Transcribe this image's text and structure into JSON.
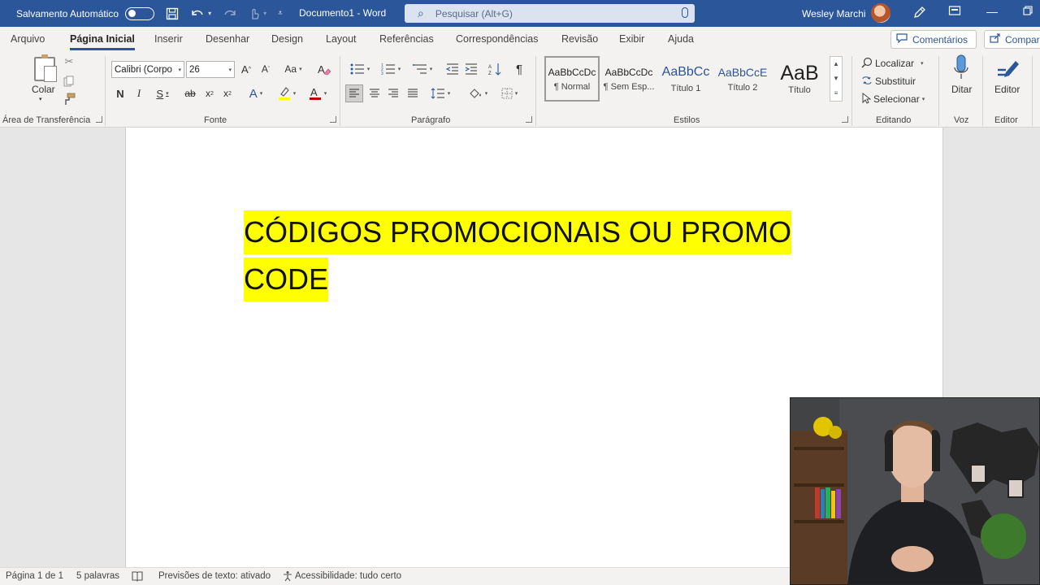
{
  "titlebar": {
    "autosave_label": "Salvamento Automático",
    "doc_title": "Documento1  -  Word",
    "search_placeholder": "Pesquisar (Alt+G)",
    "user_name": "Wesley Marchi"
  },
  "tabs": [
    {
      "label": "Arquivo"
    },
    {
      "label": "Página Inicial",
      "active": true
    },
    {
      "label": "Inserir"
    },
    {
      "label": "Desenhar"
    },
    {
      "label": "Design"
    },
    {
      "label": "Layout"
    },
    {
      "label": "Referências"
    },
    {
      "label": "Correspondências"
    },
    {
      "label": "Revisão"
    },
    {
      "label": "Exibir"
    },
    {
      "label": "Ajuda"
    }
  ],
  "comments_label": "Comentários",
  "share_label": "Compar",
  "ribbon": {
    "clipboard": {
      "paste_label": "Colar",
      "group_label": "Área de Transferência"
    },
    "font": {
      "font_name": "Calibri (Corpo",
      "font_size": "26",
      "group_label": "Fonte"
    },
    "paragraph": {
      "group_label": "Parágrafo"
    },
    "styles": {
      "group_label": "Estilos",
      "items": [
        {
          "sample": "AaBbCcDc",
          "name": "¶ Normal"
        },
        {
          "sample": "AaBbCcDc",
          "name": "¶ Sem Esp..."
        },
        {
          "sample": "AaBbCc",
          "name": "Título 1"
        },
        {
          "sample": "AaBbCcE",
          "name": "Título 2"
        },
        {
          "sample": "AaB",
          "name": "Título"
        }
      ]
    },
    "editing": {
      "find": "Localizar",
      "replace": "Substituir",
      "select": "Selecionar",
      "group_label": "Editando"
    },
    "voice": {
      "dictate": "Ditar",
      "group_label": "Voz"
    },
    "editor": {
      "label": "Editor",
      "group_label": "Editor"
    }
  },
  "document": {
    "line1": "CÓDIGOS PROMOCIONAIS OU PROMO",
    "line2": "CODE"
  },
  "status": {
    "page": "Página 1 de 1",
    "words": "5 palavras",
    "predictions": "Previsões de texto: ativado",
    "accessibility": "Acessibilidade: tudo certo"
  },
  "colors": {
    "accent": "#2b579a",
    "highlight": "#ffff00",
    "font_color": "#c00000"
  }
}
